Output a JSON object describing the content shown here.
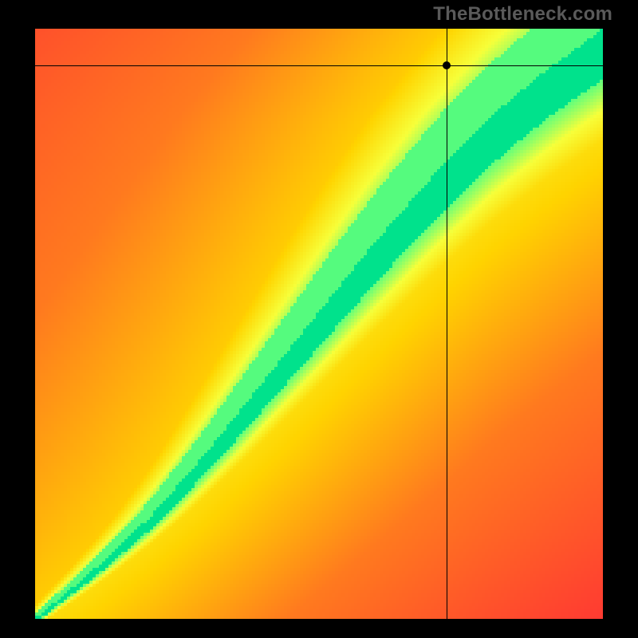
{
  "watermark": "TheBottleneck.com",
  "chart_data": {
    "type": "heatmap",
    "title": "",
    "xlabel": "",
    "ylabel": "",
    "xlim": [
      0,
      1
    ],
    "ylim": [
      0,
      1
    ],
    "legend": false,
    "grid": false,
    "description": "Diagonal optimum band heatmap. Value encodes how close a point is to an optimal diagonal curve; green = optimal, yellow = near, orange/red = far.",
    "color_scale": [
      {
        "t": 0.0,
        "color": "#ff1a3c"
      },
      {
        "t": 0.45,
        "color": "#ff7a1f"
      },
      {
        "t": 0.65,
        "color": "#ffd400"
      },
      {
        "t": 0.8,
        "color": "#f7ff3a"
      },
      {
        "t": 0.92,
        "color": "#62ff7c"
      },
      {
        "t": 1.0,
        "color": "#00e28c"
      }
    ],
    "ridge": {
      "comment": "Center of the green band as (x, y) in normalized [0,1] coords, y measured from top.",
      "points": [
        [
          0.0,
          1.0
        ],
        [
          0.1,
          0.92
        ],
        [
          0.2,
          0.83
        ],
        [
          0.3,
          0.72
        ],
        [
          0.4,
          0.6
        ],
        [
          0.5,
          0.48
        ],
        [
          0.6,
          0.36
        ],
        [
          0.7,
          0.25
        ],
        [
          0.8,
          0.15
        ],
        [
          0.9,
          0.07
        ],
        [
          1.0,
          0.0
        ]
      ],
      "band_halfwidth_at_top": 0.075,
      "band_halfwidth_at_bottom": 0.006
    },
    "crosshair": {
      "x": 0.725,
      "y": 0.062
    },
    "marker": {
      "x": 0.725,
      "y": 0.062
    }
  },
  "colors": {
    "page_bg": "#000000",
    "watermark": "#5a5a5a",
    "crosshair": "#000000",
    "marker": "#000000"
  }
}
